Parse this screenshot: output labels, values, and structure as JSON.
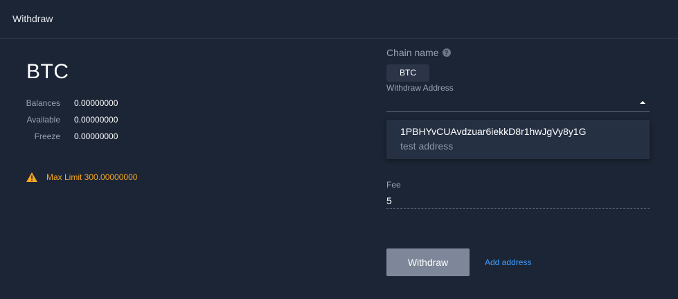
{
  "header": {
    "title": "Withdraw"
  },
  "asset": {
    "symbol": "BTC"
  },
  "balances": [
    {
      "label": "Balances",
      "value": "0.00000000"
    },
    {
      "label": "Available",
      "value": "0.00000000"
    },
    {
      "label": "Freeze",
      "value": "0.00000000"
    }
  ],
  "warning": {
    "icon": "warning-icon",
    "text": "Max Limit 300.00000000",
    "color": "#f5a623"
  },
  "chain": {
    "label": "Chain name",
    "help_icon": "question-icon",
    "selected": "BTC"
  },
  "address": {
    "label": "Withdraw Address",
    "options": [
      {
        "address": "1PBHYvCUAvdzuar6iekkD8r1hwJgVy8y1G",
        "note": "test address"
      }
    ]
  },
  "fee": {
    "label": "Fee",
    "value": "5"
  },
  "actions": {
    "withdraw_label": "Withdraw",
    "add_address_label": "Add address",
    "link_color": "#3b9eff"
  }
}
